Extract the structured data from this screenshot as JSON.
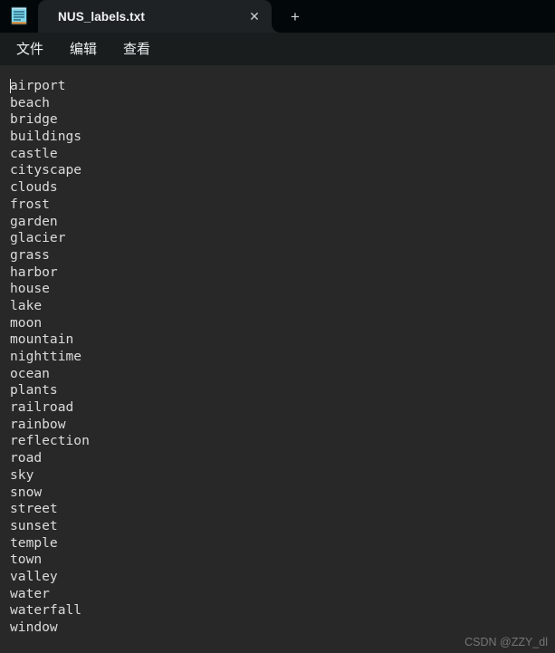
{
  "window": {
    "app_icon_name": "notepad-icon",
    "background_color": "#282828",
    "tabstrip_color": "#020809",
    "menubar_color": "#191d1e"
  },
  "tabs": {
    "items": [
      {
        "title": "NUS_labels.txt",
        "active": true
      }
    ],
    "close_label": "✕",
    "new_tab_label": "+"
  },
  "menu": {
    "items": [
      {
        "label": "文件"
      },
      {
        "label": "编辑"
      },
      {
        "label": "查看"
      }
    ]
  },
  "editor": {
    "text_color": "#dcdcdc",
    "caret_visible": true,
    "lines": [
      "airport",
      "beach",
      "bridge",
      "buildings",
      "castle",
      "cityscape",
      "clouds",
      "frost",
      "garden",
      "glacier",
      "grass",
      "harbor",
      "house",
      "lake",
      "moon",
      "mountain",
      "nighttime",
      "ocean",
      "plants",
      "railroad",
      "rainbow",
      "reflection",
      "road",
      "sky",
      "snow",
      "street",
      "sunset",
      "temple",
      "town",
      "valley",
      "water",
      "waterfall",
      "window"
    ]
  },
  "watermark": {
    "text": "CSDN @ZZY_dl"
  }
}
